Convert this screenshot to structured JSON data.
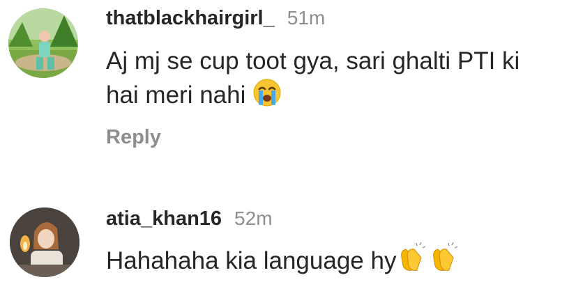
{
  "comments": [
    {
      "username": "thatblackhairgirl_",
      "time": "51m",
      "text_line1": "Aj mj se cup toot gya, sari ghalti PTI ki",
      "text_line2": "hai meri nahi",
      "emoji": "loudly-crying-face",
      "reply_label": "Reply"
    },
    {
      "username": "atia_khan16",
      "time": "52m",
      "text": "Hahahaha kia language hy",
      "emojis": [
        "clapping-hands",
        "clapping-hands"
      ]
    }
  ],
  "colors": {
    "username": "#262626",
    "muted": "#8e8e8e",
    "emoji_yellow": "#f7b500"
  }
}
